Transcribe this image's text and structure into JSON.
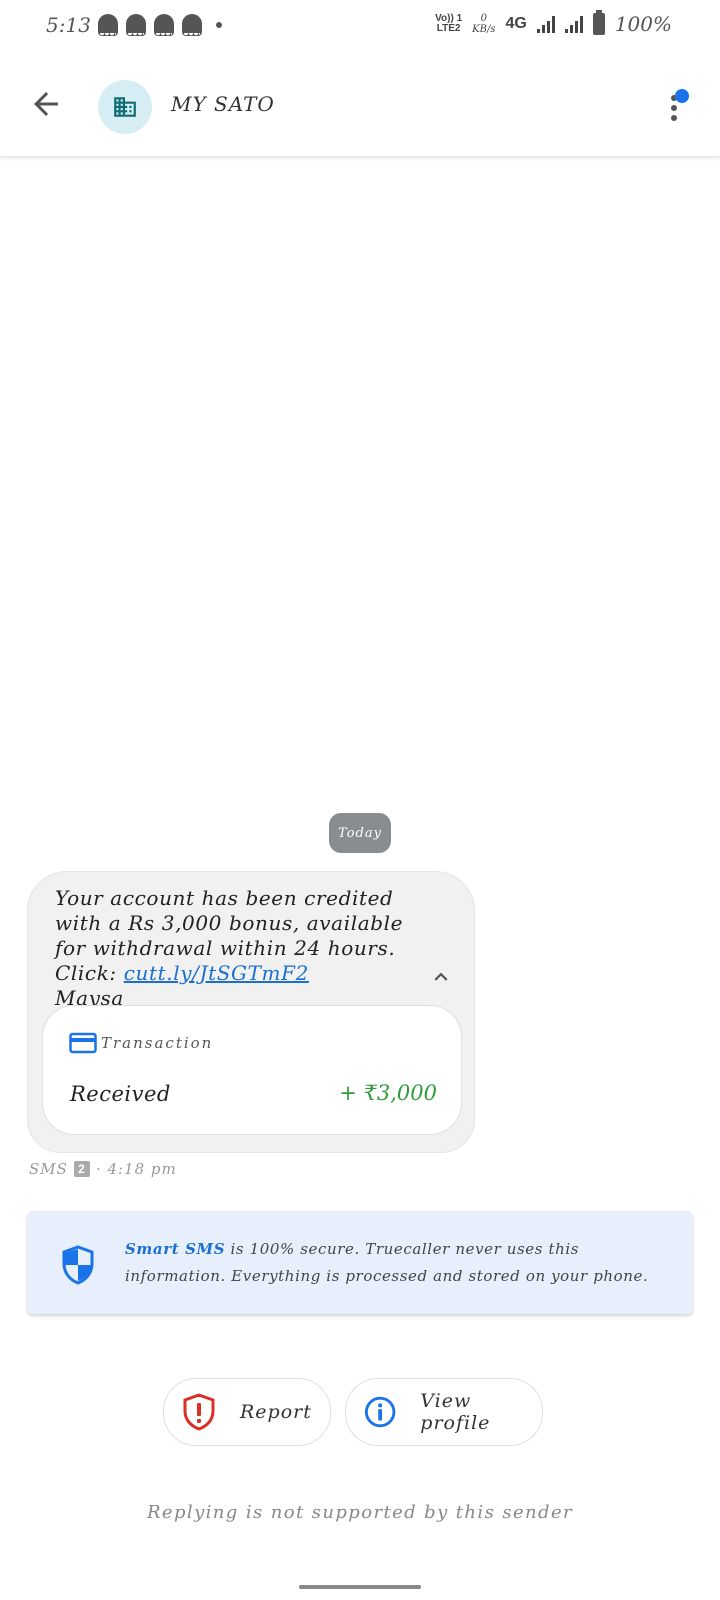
{
  "status_bar": {
    "time": "5:13",
    "volte_top": "Vo)) 1",
    "volte_bottom": "LTE2",
    "data_rate_value": "0",
    "data_rate_unit": "KB/s",
    "network_type": "4G",
    "battery_text": "100%"
  },
  "header": {
    "contact_name": "MY SATO",
    "avatar_icon": "building-icon",
    "accent_color": "#1a6fd1"
  },
  "conversation": {
    "date_chip": "Today",
    "message": {
      "text_before_link": "Your account has been credited with a Rs 3,000 bonus, available for withdrawal within 24 hours. Click: ",
      "link_text": "cutt.ly/JtSGTmF2",
      "sender_sign": "Maysa",
      "transaction": {
        "label": "Transaction",
        "status": "Received",
        "amount": "+ ₹3,000",
        "amount_color": "#2e9b3c"
      },
      "channel": "SMS",
      "sim_slot": "2",
      "timestamp": "· 4:18 pm"
    }
  },
  "smart_sms_notice": {
    "brand": "Smart SMS",
    "text": " is 100% secure. Truecaller never uses this information. Everything is processed and stored on your phone."
  },
  "actions": {
    "report_label": "Report",
    "view_profile_label": "View profile"
  },
  "footer": {
    "reply_note": "Replying is not supported by this sender"
  }
}
